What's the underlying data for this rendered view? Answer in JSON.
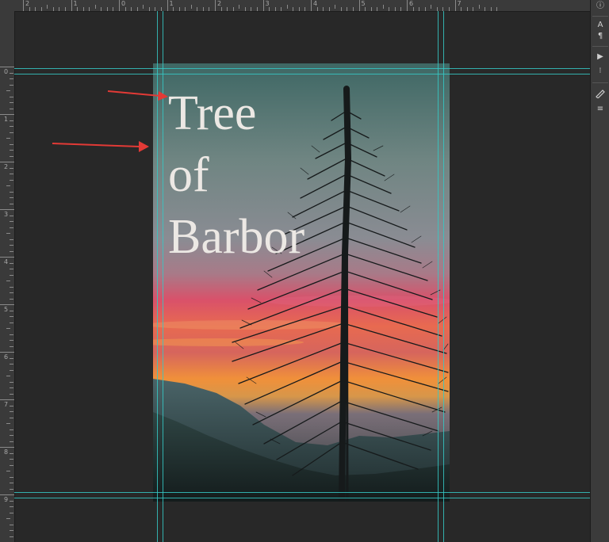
{
  "rulers": {
    "top_labels": [
      "2",
      "1",
      "0",
      "1",
      "2",
      "3",
      "4",
      "5",
      "6",
      "7"
    ],
    "left_labels": [
      "0",
      "1",
      "2",
      "3",
      "4",
      "5",
      "6",
      "7",
      "8",
      "9"
    ]
  },
  "canvas": {
    "title_lines": [
      "Tree",
      "of",
      "Barbor"
    ]
  },
  "side_panel": {
    "items": [
      "ⓘ",
      "A",
      "¶",
      "▶",
      "⁝",
      "≡"
    ]
  },
  "colors": {
    "workspace": "#282828",
    "guide": "#35c8c4",
    "arrow": "#e23a36",
    "title_text": "#ece8e4"
  }
}
